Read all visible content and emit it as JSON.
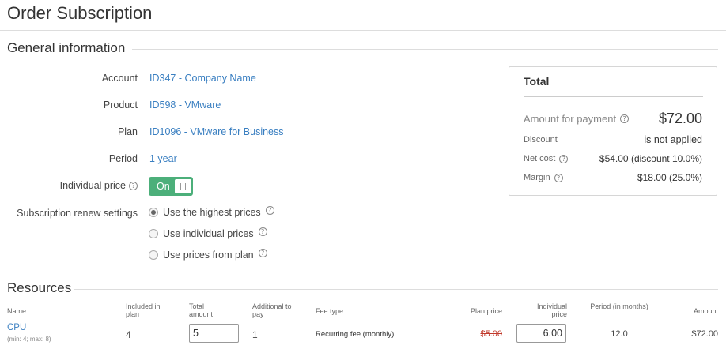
{
  "page": {
    "title": "Order Subscription"
  },
  "general": {
    "heading": "General information",
    "fields": {
      "account": {
        "label": "Account",
        "value": "ID347 - Company Name"
      },
      "product": {
        "label": "Product",
        "value": "ID598 - VMware"
      },
      "plan": {
        "label": "Plan",
        "value": "ID1096 - VMware for Business"
      },
      "period": {
        "label": "Period",
        "value": "1 year"
      },
      "individual_price": {
        "label": "Individual price",
        "toggle": "On",
        "toggle_state": true
      },
      "renew": {
        "label": "Subscription renew settings",
        "options": [
          {
            "label": "Use the highest prices",
            "selected": true
          },
          {
            "label": "Use individual prices",
            "selected": false
          },
          {
            "label": "Use prices from plan",
            "selected": false
          }
        ]
      }
    }
  },
  "total": {
    "title": "Total",
    "amount_label": "Amount for payment",
    "amount_value": "$72.00",
    "discount_label": "Discount",
    "discount_value": "is not applied",
    "net_cost_label": "Net cost",
    "net_cost_value": "$54.00 (discount 10.0%)",
    "margin_label": "Margin",
    "margin_value": "$18.00 (25.0%)"
  },
  "resources": {
    "heading": "Resources",
    "columns": {
      "name": "Name",
      "included": "Included in plan",
      "total": "Total amount",
      "additional": "Additional to pay",
      "fee_type": "Fee type",
      "plan_price": "Plan price",
      "individual_price": "Individual price",
      "period": "Period (in months)",
      "amount": "Amount"
    },
    "rows": [
      {
        "name": "CPU",
        "limits": "(min: 4; max: 8)",
        "included": "4",
        "total": "5",
        "additional": "1",
        "fee_type": "Recurring fee (monthly)",
        "plan_price": "$5.00",
        "individual_price": "6.00",
        "period": "12.0",
        "amount": "$72.00"
      }
    ]
  },
  "colors": {
    "link": "#3a7fc1",
    "toggle_on": "#4caf7a",
    "strike": "#c0392b"
  }
}
